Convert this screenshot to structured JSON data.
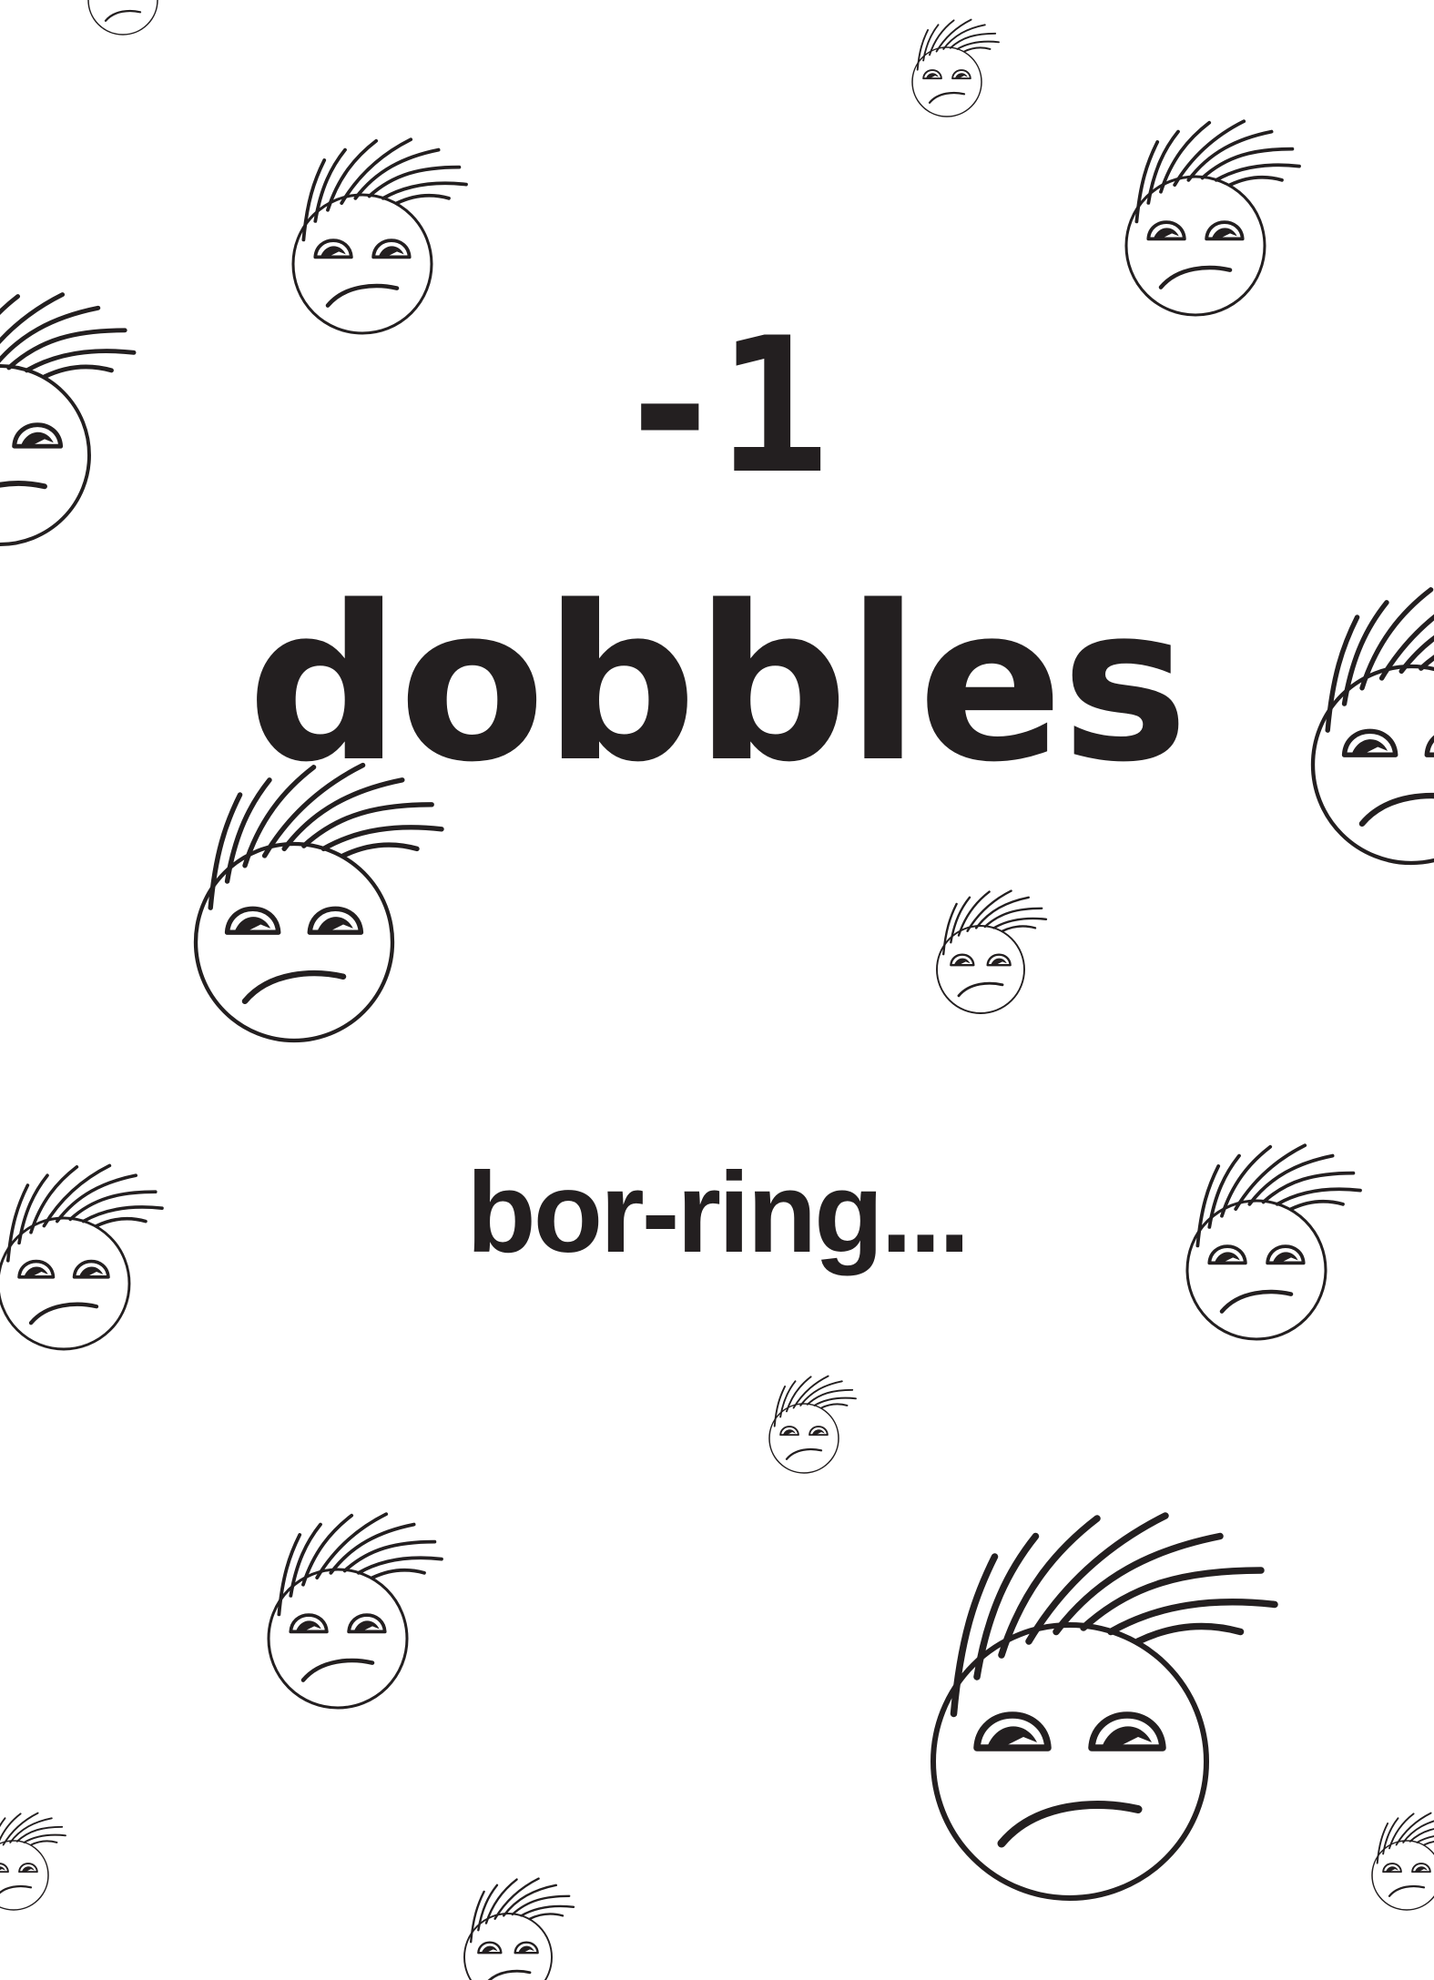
{
  "score_text": "-1",
  "title_text": "dobbles",
  "caption_text": "bor-ring...",
  "colors": {
    "ink": "#231f20",
    "background": "#ffffff"
  },
  "decoration": {
    "icon": "grumpy-face-icon"
  }
}
